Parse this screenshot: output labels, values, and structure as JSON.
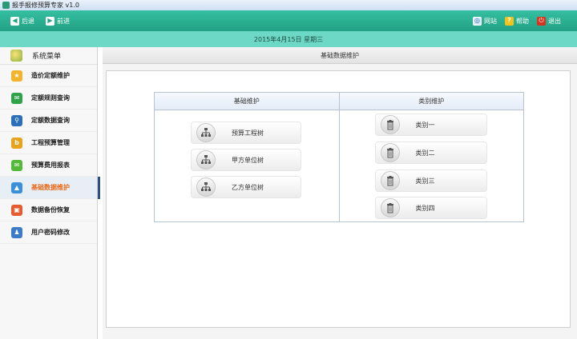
{
  "window": {
    "title": "报手报修预算专家 v1.0"
  },
  "toolbar": {
    "back": "后退",
    "forward": "前进",
    "website": "网站",
    "help": "帮助",
    "exit": "退出"
  },
  "datebar": {
    "text": "2015年4月15日 星期三"
  },
  "sidebar": {
    "header": "系统菜单",
    "items": [
      {
        "label": "造价定额维护",
        "icon": "star-icon",
        "color": "#f2b32d"
      },
      {
        "label": "定额规则查询",
        "icon": "chat-icon",
        "color": "#2fa24a"
      },
      {
        "label": "定额数据查询",
        "icon": "search-icon",
        "color": "#2a6fb8"
      },
      {
        "label": "工程预算管理",
        "icon": "b-icon",
        "color": "#e8a21c"
      },
      {
        "label": "预算费用报表",
        "icon": "chat-icon",
        "color": "#54b83a"
      },
      {
        "label": "基础数据维护",
        "icon": "picture-icon",
        "color": "#3a8fd8"
      },
      {
        "label": "数据备份恢复",
        "icon": "gift-icon",
        "color": "#e55a2f"
      },
      {
        "label": "用户密码修改",
        "icon": "users-icon",
        "color": "#3b7bc8"
      }
    ],
    "active_index": 5
  },
  "main": {
    "header": "基础数据维护",
    "panel": {
      "left_title": "基础维护",
      "right_title": "类别维护",
      "left_items": [
        "预算工程树",
        "甲方单位树",
        "乙方单位树"
      ],
      "right_items": [
        "类别一",
        "类别二",
        "类别三",
        "类别四"
      ]
    }
  }
}
